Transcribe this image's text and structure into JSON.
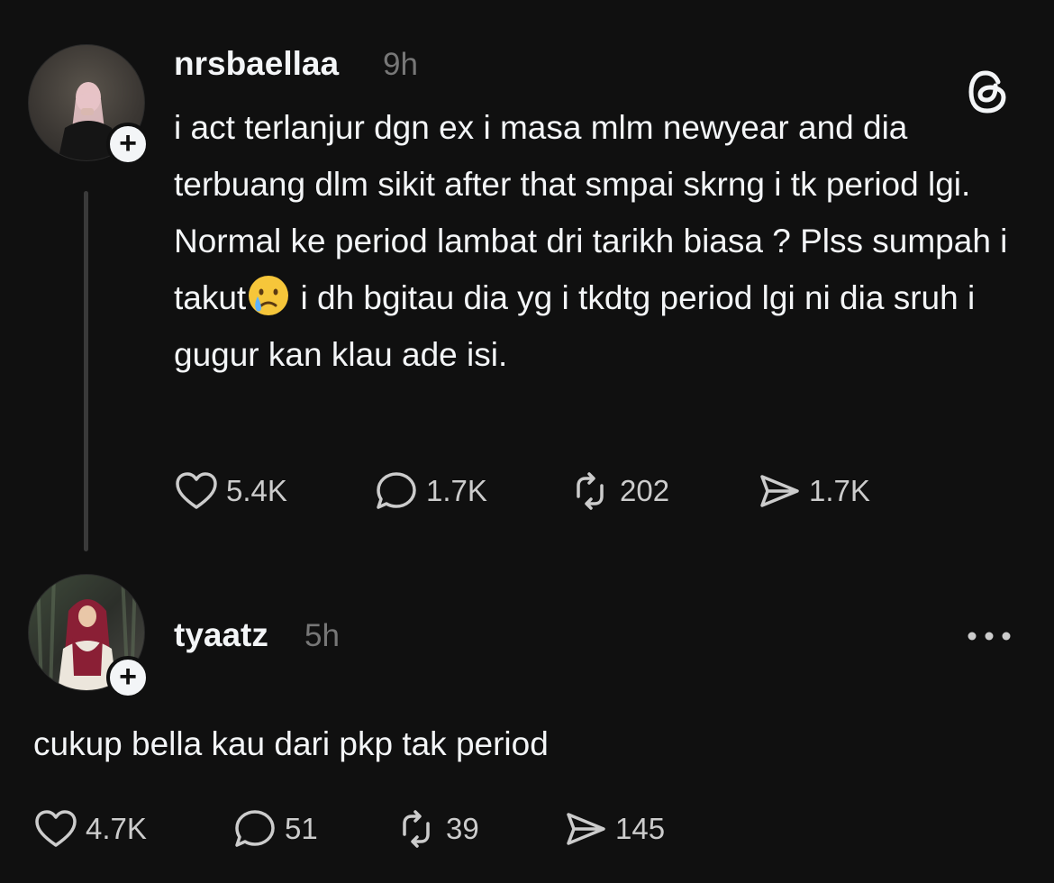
{
  "post": {
    "username": "nrsbaellaa",
    "time": "9h",
    "text_before_emoji": "i act terlanjur dgn ex i masa mlm newyear and dia terbuang dlm sikit after that smpai skrng i tk period lgi. Normal ke period lambat dri tarikh biasa ? Plss sumpah i takut",
    "text_after_emoji": " i dh bgitau dia yg i tkdtg period lgi ni dia sruh i gugur kan klau ade isi.",
    "emoji": "crying-face",
    "likes": "5.4K",
    "replies": "1.7K",
    "reposts": "202",
    "shares": "1.7K"
  },
  "reply": {
    "username": "tyaatz",
    "time": "5h",
    "text": "cukup bella kau dari pkp tak period",
    "likes": "4.7K",
    "replies": "51",
    "reposts": "39",
    "shares": "145"
  },
  "icons": {
    "logo": "threads-logo-icon",
    "more": "more-options-icon",
    "like": "heart-icon",
    "comment": "comment-bubble-icon",
    "repost": "repost-icon",
    "share": "send-icon",
    "follow": "plus-icon"
  },
  "colors": {
    "background": "#101010",
    "text": "#f3f5f7",
    "muted": "#777777",
    "counts": "#cccccc",
    "thread_line": "#3a3a3a"
  }
}
